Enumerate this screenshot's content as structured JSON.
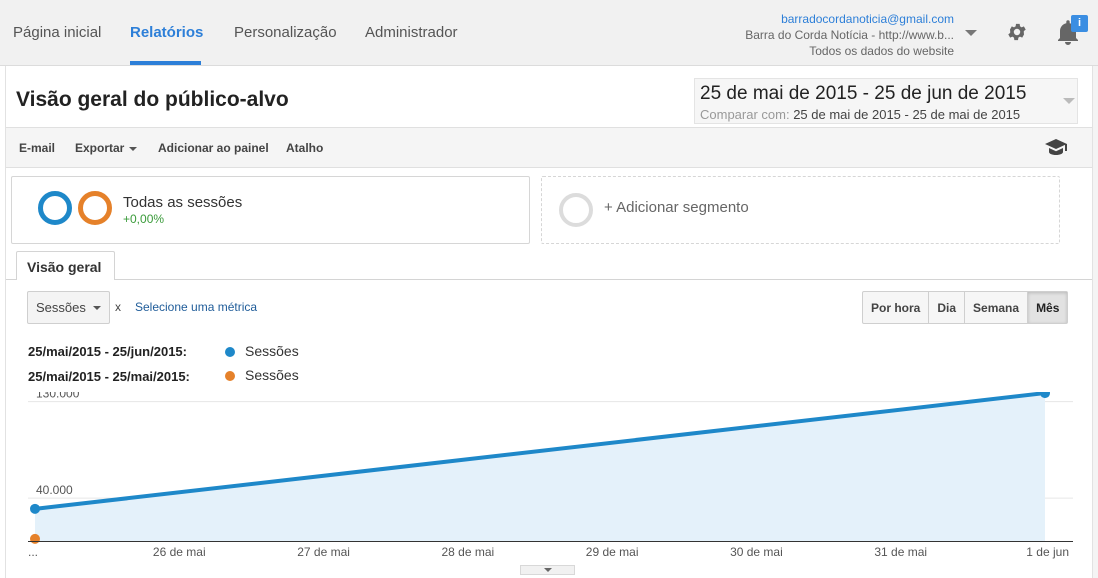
{
  "nav": {
    "items": [
      "Página inicial",
      "Relatórios",
      "Personalização",
      "Administrador"
    ],
    "active_index": 1
  },
  "account": {
    "email": "barradocordanoticia@gmail.com",
    "property": "Barra do Corda Notícia - http://www.b...",
    "view": "Todos os dados do website"
  },
  "notifications": {
    "badge": "i"
  },
  "page": {
    "title": "Visão geral do público-alvo"
  },
  "date_range": {
    "main": "25 de mai de 2015 - 25 de jun de 2015",
    "compare_label": "Comparar com:",
    "compare_value": "25 de mai de 2015 - 25 de mai de 2015"
  },
  "toolbar": {
    "email": "E-mail",
    "export": "Exportar",
    "add_dashboard": "Adicionar ao painel",
    "shortcut": "Atalho"
  },
  "segments": {
    "name": "Todas as sessões",
    "change": "+0,00%",
    "add_label": "+ Adicionar segmento",
    "colors": [
      "#1e88c9",
      "#e5812a",
      "#dcdcdc"
    ]
  },
  "tabs": {
    "overview": "Visão geral"
  },
  "chart_controls": {
    "metric": "Sessões",
    "x": "x",
    "select_metric": "Selecione uma métrica",
    "periods": [
      "Por hora",
      "Dia",
      "Semana",
      "Mês"
    ],
    "active_period": 3
  },
  "legend": [
    {
      "range": "25/mai/2015 - 25/jun/2015:",
      "name": "Sessões",
      "color": "#1e88c9"
    },
    {
      "range": "25/mai/2015 - 25/mai/2015:",
      "name": "Sessões",
      "color": "#e5812a"
    }
  ],
  "chart_data": {
    "type": "line",
    "x_labels": [
      "...",
      "26 de mai",
      "27 de mai",
      "28 de mai",
      "29 de mai",
      "30 de mai",
      "31 de mai",
      "1 de jun"
    ],
    "y_ticks": [
      "130.000",
      "40.000"
    ],
    "y_tick_values": [
      130000,
      40000
    ],
    "ylim": [
      0,
      139000
    ],
    "series": [
      {
        "name": "Sessões",
        "color": "#1e88c9",
        "points": [
          [
            0,
            30000
          ],
          [
            7,
            138000
          ]
        ]
      },
      {
        "name": "Sessões",
        "color": "#e5812a",
        "points": [
          [
            0,
            2000
          ]
        ]
      }
    ]
  }
}
